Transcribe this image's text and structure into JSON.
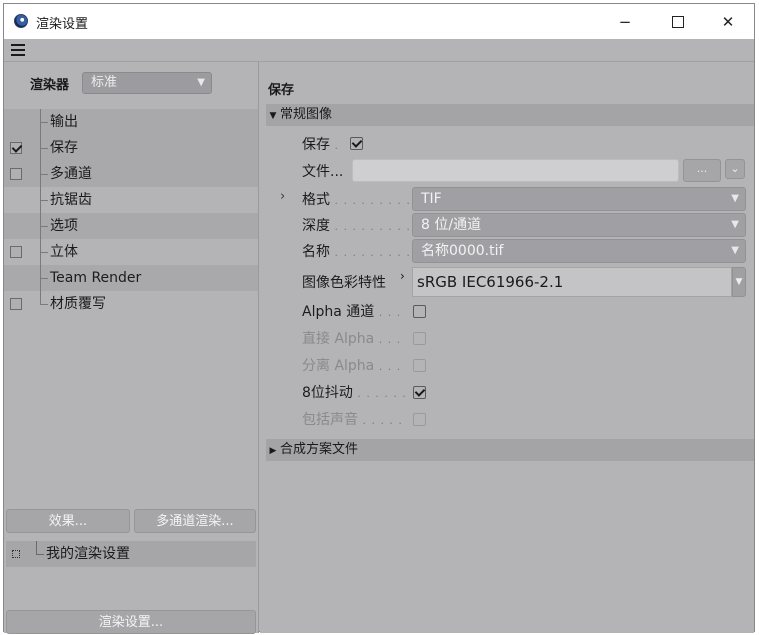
{
  "window": {
    "title": "渲染设置",
    "minimize": "−",
    "close": "✕"
  },
  "left": {
    "renderer_label": "渲染器",
    "renderer_value": "标准",
    "items": [
      {
        "label": "输出",
        "checkbox": false,
        "checked": false
      },
      {
        "label": "保存",
        "checkbox": true,
        "checked": true
      },
      {
        "label": "多通道",
        "checkbox": true,
        "checked": false
      },
      {
        "label": "抗锯齿",
        "checkbox": false,
        "checked": false
      },
      {
        "label": "选项",
        "checkbox": false,
        "checked": false
      },
      {
        "label": "立体",
        "checkbox": true,
        "checked": false
      },
      {
        "label": "Team Render",
        "checkbox": false,
        "checked": false
      },
      {
        "label": "材质覆写",
        "checkbox": true,
        "checked": false
      }
    ],
    "effects_button": "效果...",
    "multipass_button": "多通道渲染...",
    "preset_label": "我的渲染设置",
    "render_settings_button": "渲染设置..."
  },
  "right": {
    "section_title": "保存",
    "group_regular": "常规图像",
    "save_label": "保存",
    "file_label": "文件...",
    "file_value": "",
    "browse_button": "...",
    "format_label": "格式",
    "format_value": "TIF",
    "depth_label": "深度",
    "depth_value": "8 位/通道",
    "name_label": "名称",
    "name_value": "名称0000.tif",
    "color_profile_label": "图像色彩特性",
    "color_profile_value": "sRGB IEC61966-2.1",
    "alpha_label": "Alpha 通道",
    "straight_alpha_label": "直接 Alpha",
    "separate_alpha_label": "分离 Alpha",
    "dither_label": "8位抖动",
    "sound_label": "包括声音",
    "group_compositing": "合成方案文件"
  }
}
